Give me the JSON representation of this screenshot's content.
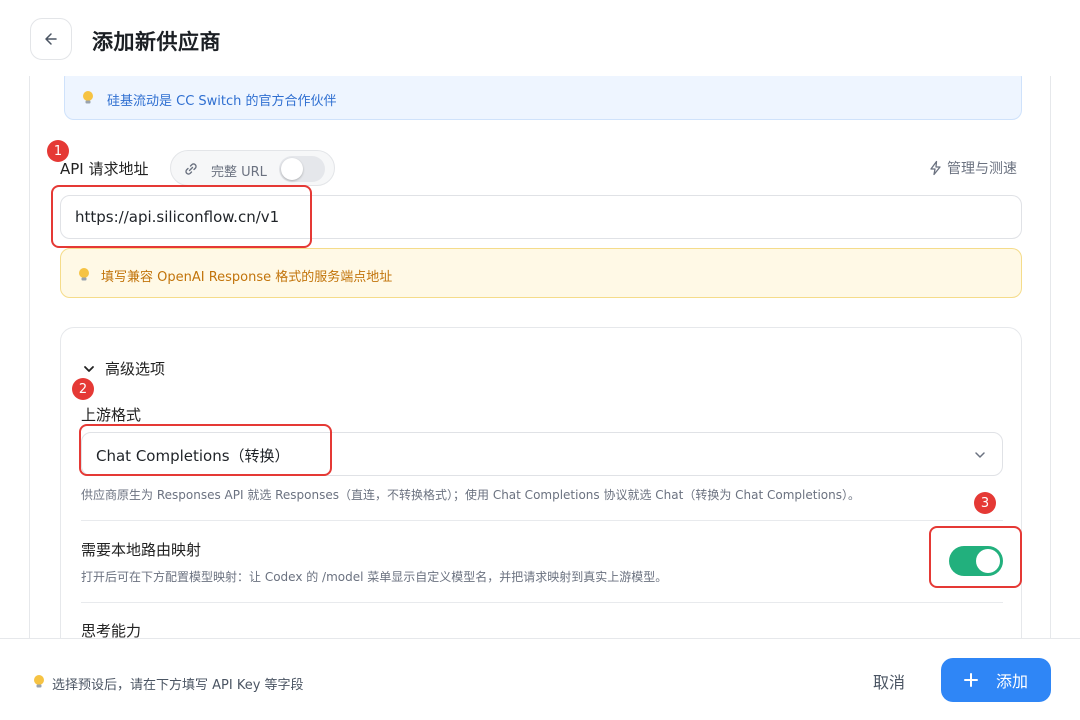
{
  "header": {
    "title": "添加新供应商"
  },
  "partner_notice": {
    "text": "硅基流动是 CC Switch 的官方合作伙伴"
  },
  "api_url": {
    "label": "API 请求地址",
    "full_url_toggle_label": "完整 URL",
    "full_url_enabled": false,
    "manage_label": "管理与测速",
    "value": "https://api.siliconflow.cn/v1"
  },
  "warn_notice": {
    "text": "填写兼容 OpenAI Response 格式的服务端点地址"
  },
  "advanced": {
    "toggle_label": "高级选项",
    "upstream_format": {
      "label": "上游格式",
      "selected": "Chat Completions（转换）",
      "help": "供应商原生为 Responses API 就选 Responses（直连，不转换格式）；使用 Chat Completions 协议就选 Chat（转换为 Chat Completions）。"
    },
    "local_routing": {
      "label": "需要本地路由映射",
      "help": "打开后可在下方配置模型映射：让 Codex 的 /model 菜单显示自定义模型名，并把请求映射到真实上游模型。",
      "enabled": true
    },
    "thinking": {
      "label": "思考能力"
    }
  },
  "footer": {
    "hint": "选择预设后，请在下方填写 API Key 等字段",
    "cancel_label": "取消",
    "add_label": "添加"
  },
  "annotations": {
    "m1": "1",
    "m2": "2",
    "m3": "3"
  },
  "colors": {
    "accent": "#2f86f6",
    "toggle_on": "#22b07d",
    "annotation": "#e53935"
  }
}
